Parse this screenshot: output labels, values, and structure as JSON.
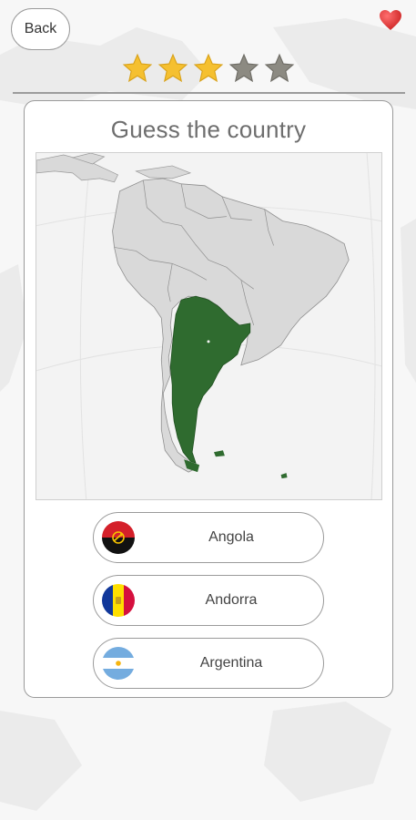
{
  "header": {
    "back_label": "Back",
    "lives_icon": "heart-icon",
    "rating": {
      "filled": 3,
      "total": 5
    }
  },
  "colors": {
    "star_filled": "#f5c030",
    "star_empty": "#8c8a82",
    "highlight_country": "#2f6b2f",
    "land": "#d9d9d9",
    "heart": "#e53935"
  },
  "quiz": {
    "title": "Guess the country",
    "map_icon": "south-america-map",
    "answers": [
      {
        "label": "Angola",
        "flag_icon": "angola-flag-icon"
      },
      {
        "label": "Andorra",
        "flag_icon": "andorra-flag-icon"
      },
      {
        "label": "Argentina",
        "flag_icon": "argentina-flag-icon"
      }
    ]
  }
}
